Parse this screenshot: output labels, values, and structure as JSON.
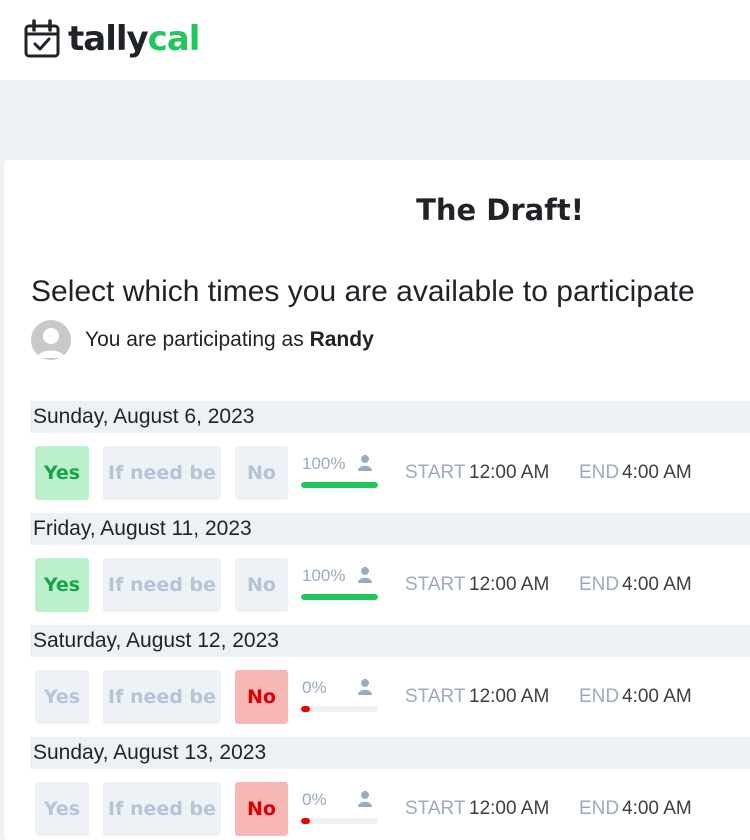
{
  "logo": {
    "part1": "tally",
    "part2": "cal"
  },
  "event": {
    "title": "The Draft!"
  },
  "prompt": "Select which times you are available to participate",
  "participant": {
    "prefix": "You are participating as",
    "name": "Randy"
  },
  "labels": {
    "yes": "Yes",
    "if_need_be": "If need be",
    "no": "No",
    "start": "START",
    "end": "END"
  },
  "colors": {
    "brand": "#22c55e",
    "yes_bg": "#bbf0cc",
    "no_bg": "#f8b7b7",
    "bar_yes": "#22c55e",
    "bar_no": "#ee0000"
  },
  "dates": [
    {
      "date": "Sunday, August 6, 2023",
      "selected": "yes",
      "percent": "100%",
      "fill": 1.0,
      "start": "12:00 AM",
      "end": "4:00 AM"
    },
    {
      "date": "Friday, August 11, 2023",
      "selected": "yes",
      "percent": "100%",
      "fill": 1.0,
      "start": "12:00 AM",
      "end": "4:00 AM"
    },
    {
      "date": "Saturday, August 12, 2023",
      "selected": "no",
      "percent": "0%",
      "fill": 0.0,
      "start": "12:00 AM",
      "end": "4:00 AM"
    },
    {
      "date": "Sunday, August 13, 2023",
      "selected": "no",
      "percent": "0%",
      "fill": 0.0,
      "start": "12:00 AM",
      "end": "4:00 AM"
    }
  ]
}
